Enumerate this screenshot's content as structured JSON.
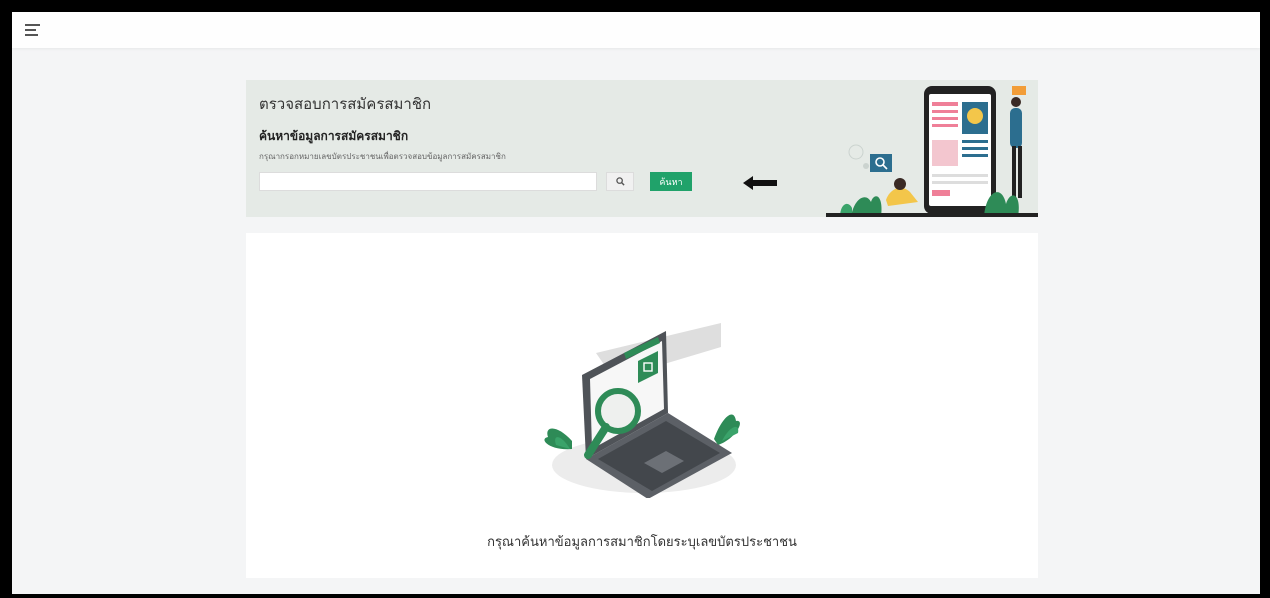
{
  "page": {
    "title": "ตรวจสอบการสมัครสมาชิก"
  },
  "search": {
    "section_title": "ค้นหาข้อมูลการสมัครสมาชิก",
    "helper_text": "กรุณากรอกหมายเลขบัตรประชาชนเพื่อตรวจสอบข้อมูลการสมัครสมาชิก",
    "input_value": "",
    "placeholder": "",
    "button_label": "ค้นหา"
  },
  "result": {
    "empty_message": "กรุณาค้นหาข้อมูลการสมาชิกโดยระบุเลขบัตรประชาชน"
  },
  "icons": {
    "menu": "hamburger-icon",
    "search": "magnifier-icon",
    "annotation": "left-arrow-icon"
  },
  "colors": {
    "accent": "#20a26a",
    "card_bg": "#e5eae6",
    "page_bg": "#f4f5f6"
  }
}
